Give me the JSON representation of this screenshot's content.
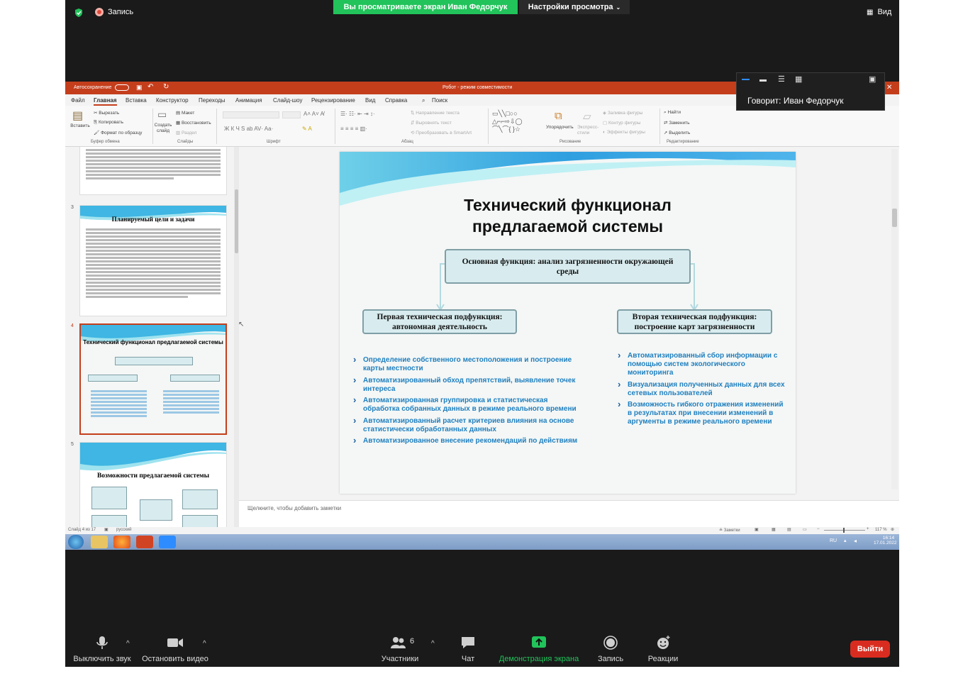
{
  "zoom": {
    "security_shield": "shield-check-icon",
    "recording_label": "Запись",
    "share_banner": "Вы просматриваете экран Иван Федорчук",
    "view_options": "Настройки просмотра",
    "view_button": "Вид",
    "speaker_label": "Говорит: Иван Федорчук"
  },
  "powerpoint": {
    "autosave": "Автосохранение",
    "doc_title": "Робот - режим совместимости",
    "tabs": [
      "Файл",
      "Главная",
      "Вставка",
      "Конструктор",
      "Переходы",
      "Анимация",
      "Слайд-шоу",
      "Рецензирование",
      "Вид",
      "Справка",
      "Поиск"
    ],
    "ribbon": {
      "paste": "Вставить",
      "cut": "Вырезать",
      "copy": "Копировать",
      "format_painter": "Формат по образцу",
      "clipboard": "Буфер обмена",
      "new_slide": "Создать слайд",
      "layout": "Макет",
      "reset": "Восстановить",
      "section": "Раздел",
      "slides": "Слайды",
      "font": "Шрифт",
      "text_direction": "Направление текста",
      "align_text": "Выровнять текст",
      "smartart": "Преобразовать в SmartArt",
      "paragraph": "Абзац",
      "arrange": "Упорядочить",
      "quick_styles": "Экспресс-стили",
      "shape_fill": "Заливка фигуры",
      "shape_outline": "Контур фигуры",
      "shape_effects": "Эффекты фигуры",
      "drawing": "Рисование",
      "find": "Найти",
      "replace": "Заменить",
      "select": "Выделить",
      "editing": "Редактирование"
    },
    "thumbnails": {
      "n3": "3",
      "n4": "4",
      "n5": "5",
      "t3_title": "Планируемый цели и задачи",
      "t4_title": "Технический функционал предлагаемой системы",
      "t5_title": "Возможности предлагаемой системы"
    },
    "slide": {
      "title_line1": "Технический функционал",
      "title_line2": "предлагаемой системы",
      "main_function": "Основная функция: анализ загрязненности окружающей среды",
      "sub1": "Первая техническая подфункция: автономная деятельность",
      "sub2": "Вторая техническая подфункция: построение карт загрязненности",
      "left_bullets": [
        "Определение собственного местоположения и построение карты местности",
        "Автоматизированный обход препятствий, выявление точек интереса",
        "Автоматизированная группировка и статистическая обработка собранных данных в режиме реального времени",
        "Автоматизированный расчет критериев влияния на основе статистически обработанных данных",
        "Автоматизированное внесение рекомендаций по действиям"
      ],
      "right_bullets": [
        "Автоматизированный сбор информации с помощью систем экологического мониторинга",
        "Визуализация полученных данных для всех сетевых пользователей",
        "Возможность гибкого отражения изменений в результатах при внесении изменений в аргументы в режиме реального времени"
      ]
    },
    "notes_placeholder": "Щелкните, чтобы добавить заметки",
    "status": {
      "slide_of": "Слайд 4 из 17",
      "language": "русский",
      "notes": "Заметки",
      "zoom": "117 %"
    },
    "taskbar": {
      "lang": "RU",
      "time": "16:14",
      "date": "17.01.2022"
    }
  },
  "toolbar": {
    "mute": "Выключить звук",
    "stop_video": "Остановить видео",
    "participants": "Участники",
    "participants_count": "6",
    "chat": "Чат",
    "share": "Демонстрация экрана",
    "record": "Запись",
    "reactions": "Реакции",
    "leave": "Выйти"
  },
  "colors": {
    "share_green": "#21c35a",
    "ppt_red": "#c43e1c",
    "bullet_blue": "#1f7fbf",
    "leave_red": "#d92c20"
  }
}
